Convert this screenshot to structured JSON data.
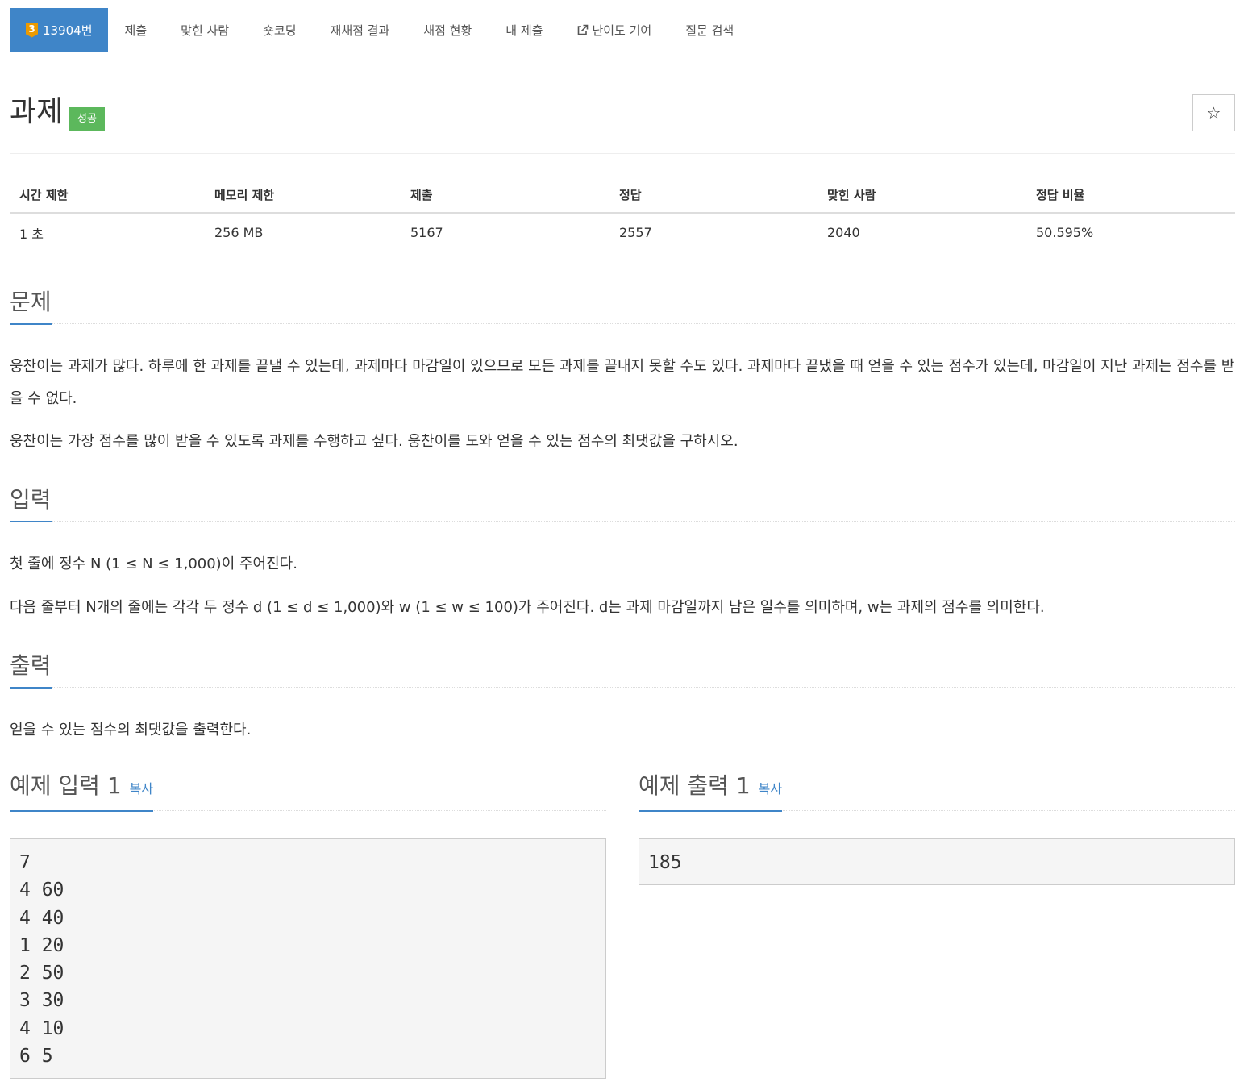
{
  "nav": {
    "problem_tier": "3",
    "problem_id": "13904번",
    "items": [
      "제출",
      "맞힌 사람",
      "숏코딩",
      "재채점 결과",
      "채점 현황",
      "내 제출",
      "난이도 기여",
      "질문 검색"
    ]
  },
  "title": {
    "text": "과제",
    "status": "성공",
    "star": "☆"
  },
  "info": {
    "headers": [
      "시간 제한",
      "메모리 제한",
      "제출",
      "정답",
      "맞힌 사람",
      "정답 비율"
    ],
    "values": [
      "1 초",
      "256 MB",
      "5167",
      "2557",
      "2040",
      "50.595%"
    ]
  },
  "problem": {
    "heading": "문제",
    "p1": "웅찬이는 과제가 많다. 하루에 한 과제를 끝낼 수 있는데, 과제마다 마감일이 있으므로 모든 과제를 끝내지 못할 수도 있다. 과제마다 끝냈을 때 얻을 수 있는 점수가 있는데, 마감일이 지난 과제는 점수를 받을 수 없다.",
    "p2": "웅찬이는 가장 점수를 많이 받을 수 있도록 과제를 수행하고 싶다. 웅찬이를 도와 얻을 수 있는 점수의 최댓값을 구하시오."
  },
  "input": {
    "heading": "입력",
    "p1": "첫 줄에 정수 N (1 ≤ N ≤ 1,000)이 주어진다.",
    "p2": "다음 줄부터 N개의 줄에는 각각 두 정수 d (1 ≤ d ≤ 1,000)와 w (1 ≤ w ≤ 100)가 주어진다. d는 과제 마감일까지 남은 일수를 의미하며, w는 과제의 점수를 의미한다."
  },
  "output": {
    "heading": "출력",
    "p1": "얻을 수 있는 점수의 최댓값을 출력한다."
  },
  "sample_input": {
    "heading": "예제 입력 1",
    "copy": "복사",
    "content": "7\n4 60\n4 40\n1 20\n2 50\n3 30\n4 10\n6 5"
  },
  "sample_output": {
    "heading": "예제 출력 1",
    "copy": "복사",
    "content": "185"
  },
  "colors": {
    "accent": "#3f85c8",
    "success": "#5cb85c",
    "tier": "#ec9a00"
  }
}
